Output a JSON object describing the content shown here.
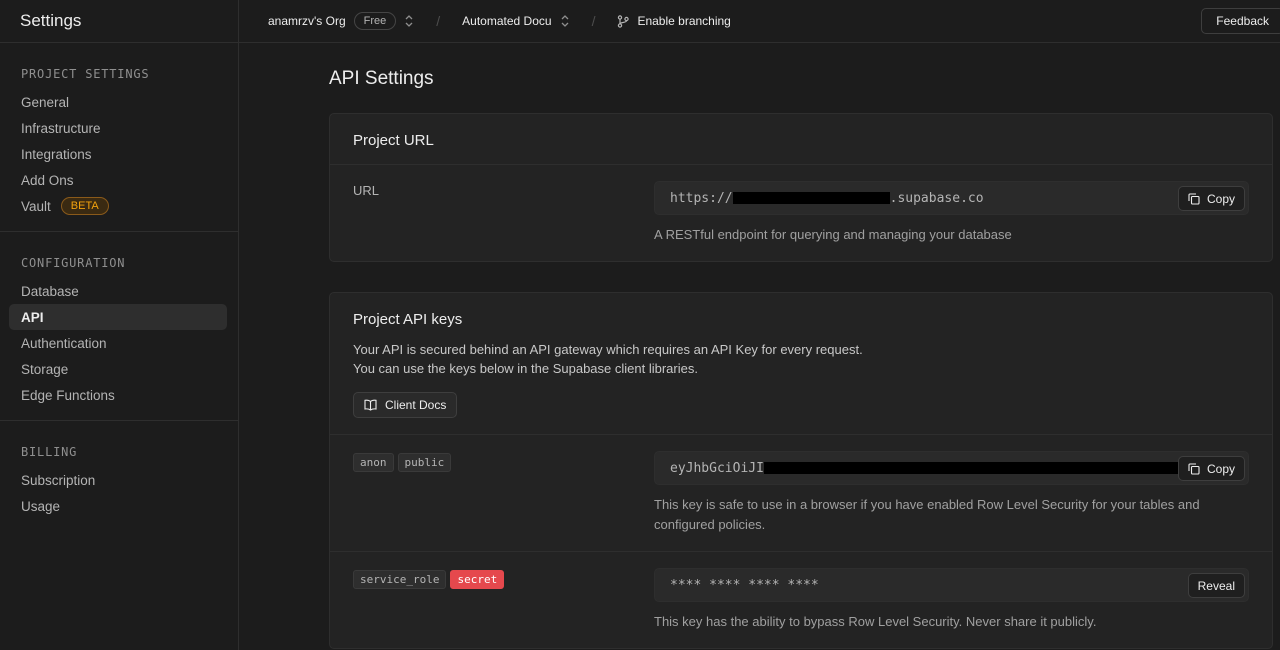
{
  "sidebar": {
    "title": "Settings",
    "sections": [
      {
        "heading": "PROJECT SETTINGS",
        "items": [
          "General",
          "Infrastructure",
          "Integrations",
          "Add Ons",
          "Vault"
        ],
        "vault_badge": "BETA"
      },
      {
        "heading": "CONFIGURATION",
        "items": [
          "Database",
          "API",
          "Authentication",
          "Storage",
          "Edge Functions"
        ],
        "active": "API"
      },
      {
        "heading": "BILLING",
        "items": [
          "Subscription",
          "Usage"
        ]
      }
    ]
  },
  "topbar": {
    "org": "anamrzv's Org",
    "plan_badge": "Free",
    "project": "Automated Docu",
    "branching": "Enable branching",
    "feedback": "Feedback"
  },
  "main": {
    "title": "API Settings",
    "project_url": {
      "header": "Project URL",
      "label": "URL",
      "value_prefix": "https://",
      "value_suffix": ".supabase.co",
      "copy": "Copy",
      "help": "A RESTful endpoint for querying and managing your database"
    },
    "api_keys": {
      "header": "Project API keys",
      "desc_line1": "Your API is secured behind an API gateway which requires an API Key for every request.",
      "desc_line2": "You can use the keys below in the Supabase client libraries.",
      "docs_button": "Client Docs",
      "anon": {
        "tag1": "anon",
        "tag2": "public",
        "value_prefix": "eyJhbGciOiJI",
        "copy": "Copy",
        "help": "This key is safe to use in a browser if you have enabled Row Level Security for your tables and configured policies."
      },
      "service": {
        "tag1": "service_role",
        "tag2": "secret",
        "value": "**** **** **** ****",
        "reveal": "Reveal",
        "help": "This key has the ability to bypass Row Level Security. Never share it publicly."
      }
    }
  },
  "colors": {
    "accent_beta": "#f1a10d",
    "secret_tag": "#e5484d",
    "background": "#1c1c1c"
  },
  "icons": [
    "chevron-updown-icon",
    "git-branch-icon",
    "copy-icon",
    "book-icon"
  ]
}
